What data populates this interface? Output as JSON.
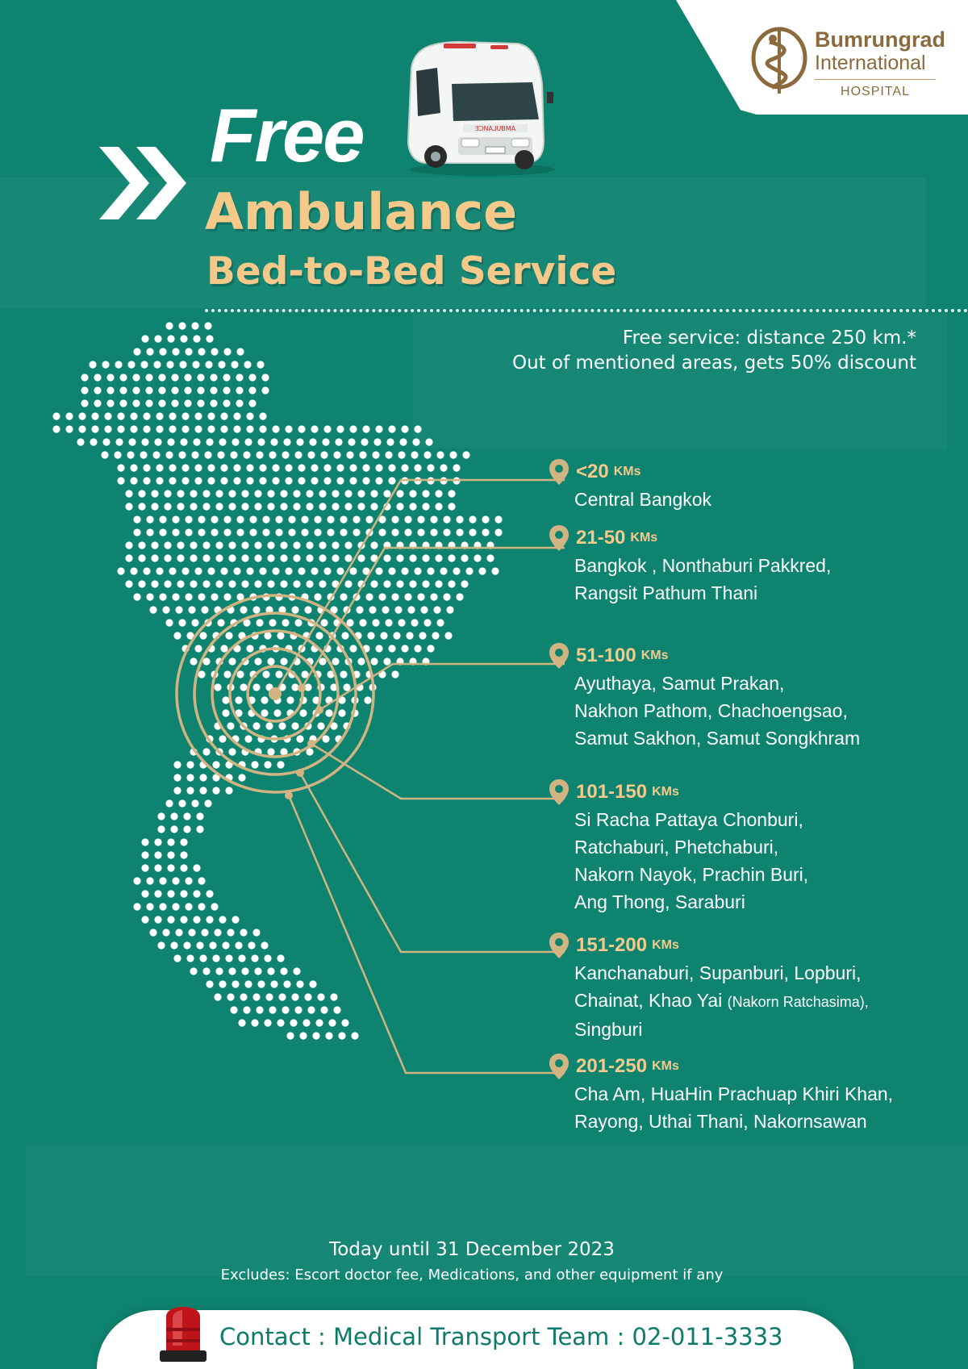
{
  "logo": {
    "line1": "Bumrungrad",
    "line2": "International",
    "line3": "HOSPITAL"
  },
  "title": {
    "free": "Free",
    "ambulance": "Ambulance",
    "service": "Bed-to-Bed Service"
  },
  "info": {
    "line1": "Free service: distance 250 km.*",
    "line2": "Out of mentioned areas, gets 50% discount"
  },
  "ranges": [
    {
      "km": "<20",
      "unit": "KMs",
      "lines": [
        "Central Bangkok"
      ]
    },
    {
      "km": "21-50",
      "unit": "KMs",
      "lines": [
        "Bangkok , Nonthaburi Pakkred,",
        "Rangsit Pathum Thani"
      ]
    },
    {
      "km": "51-100",
      "unit": "KMs",
      "lines": [
        "Ayuthaya, Samut Prakan,",
        "Nakhon Pathom, Chachoengsao,",
        "Samut Sakhon, Samut Songkhram"
      ]
    },
    {
      "km": "101-150",
      "unit": "KMs",
      "lines": [
        "Si Racha  Pattaya  Chonburi,",
        "Ratchaburi, Phetchaburi,",
        "Nakorn Nayok, Prachin Buri,",
        "Ang Thong, Saraburi"
      ]
    },
    {
      "km": "151-200",
      "unit": "KMs",
      "lines": [
        "Kanchanaburi, Supanburi, Lopburi,",
        "Chainat, Khao Yai",
        "Singburi"
      ],
      "note": "(Nakorn Ratchasima),"
    },
    {
      "km": "201-250",
      "unit": "KMs",
      "lines": [
        "Cha Am, HuaHin Prachuap Khiri Khan,",
        "Rayong, Uthai Thani, Nakornsawan"
      ]
    }
  ],
  "footer": {
    "period": "Today until 31 December 2023",
    "excludes": "Excludes: Escort doctor fee, Medications, and other equipment if any",
    "contact": "Contact : Medical Transport Team : 02-011-3333"
  },
  "colors": {
    "background": "#0e8470",
    "accent": "#f4c98a",
    "gold_line": "#d2b483",
    "logo_brown": "#8b6b3d",
    "contact_text": "#0e7a68"
  }
}
